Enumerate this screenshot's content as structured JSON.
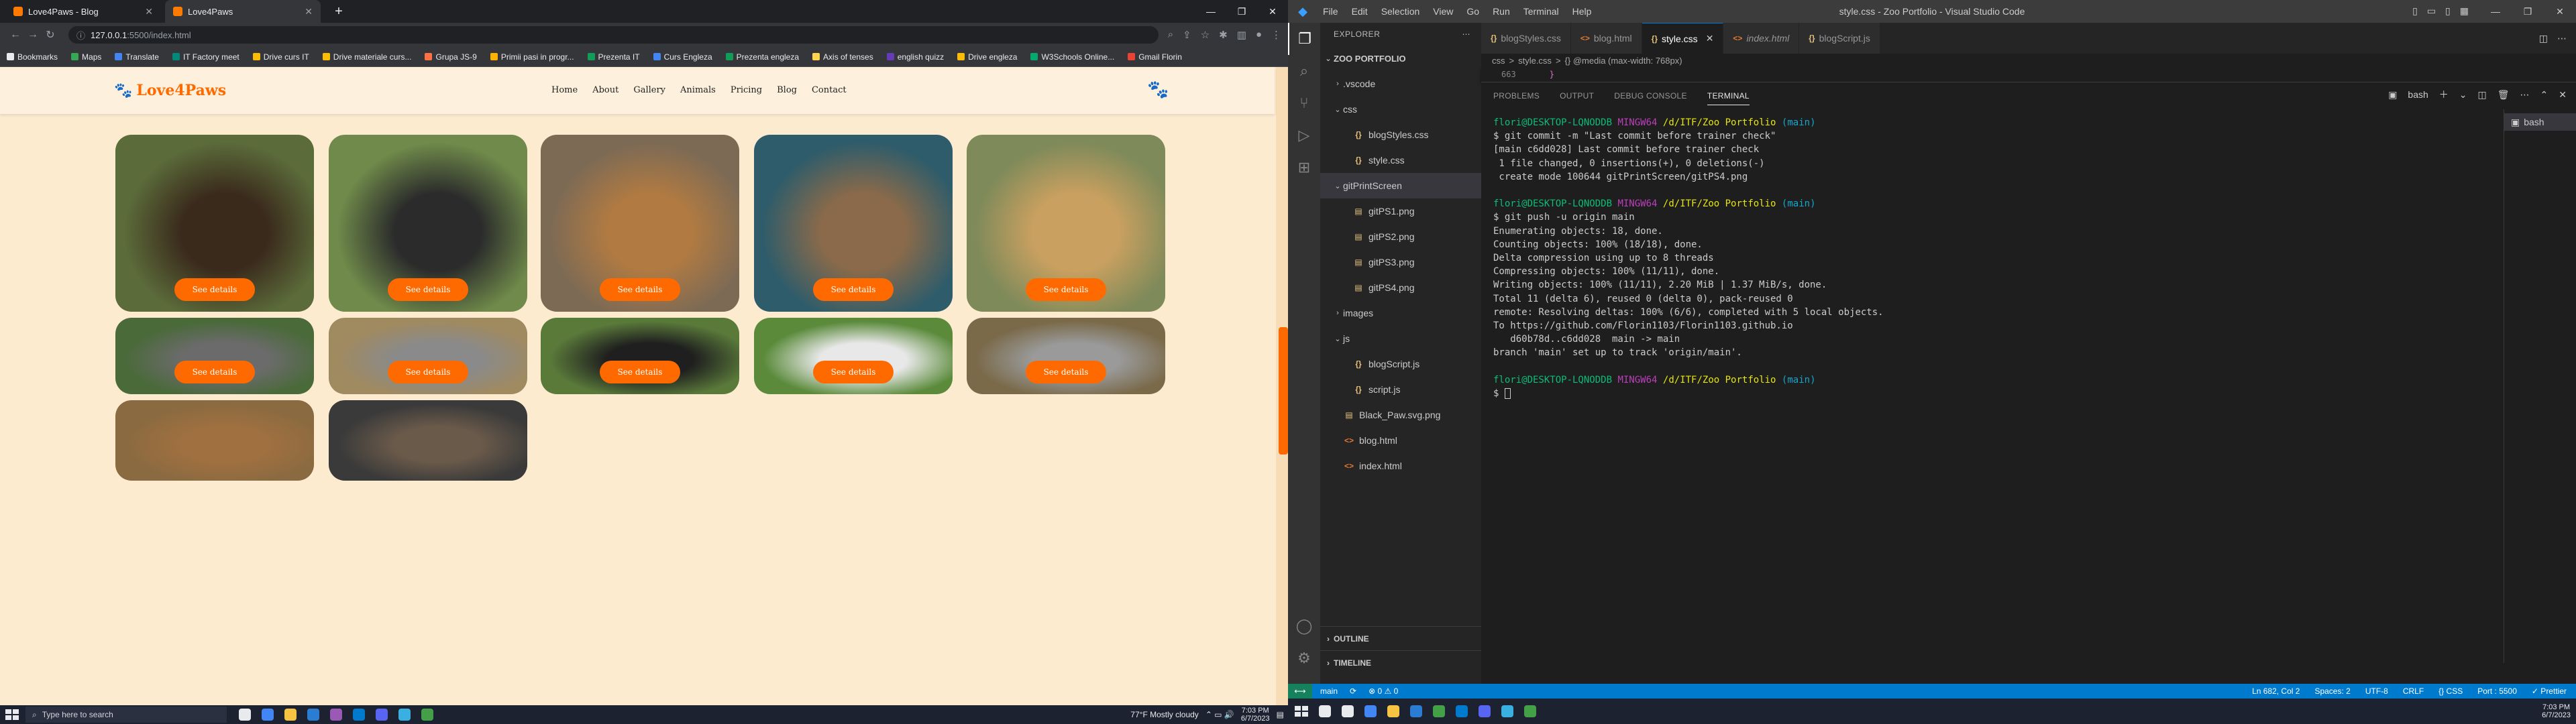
{
  "browser": {
    "tabs": [
      {
        "label": "Love4Paws - Blog",
        "active": false
      },
      {
        "label": "Love4Paws",
        "active": true
      }
    ],
    "new_tab": "+",
    "window_controls": [
      "—",
      "❐",
      "✕"
    ],
    "url_host": "127.0.0.1",
    "url_path": ":5500/index.html",
    "bookmarks": [
      {
        "label": "Bookmarks",
        "color": "#e8eaed"
      },
      {
        "label": "Maps",
        "color": "#34a853"
      },
      {
        "label": "Translate",
        "color": "#4285f4"
      },
      {
        "label": "IT Factory meet",
        "color": "#00897b"
      },
      {
        "label": "Drive curs IT",
        "color": "#fbbc04"
      },
      {
        "label": "Drive materiale curs...",
        "color": "#fbbc04"
      },
      {
        "label": "Grupa JS-9",
        "color": "#ff7043"
      },
      {
        "label": "Primii pasi in progr...",
        "color": "#ffb300"
      },
      {
        "label": "Prezenta IT",
        "color": "#0f9d58"
      },
      {
        "label": "Curs Engleza",
        "color": "#4285f4"
      },
      {
        "label": "Prezenta engleza",
        "color": "#0f9d58"
      },
      {
        "label": "Axis of tenses",
        "color": "#ffd54f"
      },
      {
        "label": "english quizz",
        "color": "#673ab7"
      },
      {
        "label": "Drive engleza",
        "color": "#fbbc04"
      },
      {
        "label": "W3Schools Online...",
        "color": "#04aa6d"
      },
      {
        "label": "Gmail Florin",
        "color": "#ea4335"
      }
    ]
  },
  "site": {
    "logo_text": "Love4Paws",
    "nav": [
      "Home",
      "About",
      "Gallery",
      "Animals",
      "Pricing",
      "Blog",
      "Contact"
    ],
    "button_label": "See details",
    "cards": [
      {
        "animal": "bear",
        "c1": "#5b6b3a",
        "c2": "#3a2a1c"
      },
      {
        "animal": "zebra",
        "c1": "#6f8a4a",
        "c2": "#2b2b2b"
      },
      {
        "animal": "giraffe",
        "c1": "#7c6a55",
        "c2": "#b07a42"
      },
      {
        "animal": "monkey",
        "c1": "#2f5c6a",
        "c2": "#8a6a4a"
      },
      {
        "animal": "serval",
        "c1": "#7f8a5a",
        "c2": "#c9a060"
      },
      {
        "animal": "raccoon",
        "c1": "#4a6a3a",
        "c2": "#6b6b6b"
      },
      {
        "animal": "wolf",
        "c1": "#a08a60",
        "c2": "#8a8a8a"
      },
      {
        "animal": "gorilla",
        "c1": "#5a7a3a",
        "c2": "#1f1f1f"
      },
      {
        "animal": "white tiger",
        "c1": "#5a8a3a",
        "c2": "#e8e8e8"
      },
      {
        "animal": "koala",
        "c1": "#7a6a4a",
        "c2": "#9a9a9a"
      },
      {
        "animal": "lion",
        "c1": "#8a6a40",
        "c2": "#a07040"
      },
      {
        "animal": "deer",
        "c1": "#3a3a3a",
        "c2": "#6a5a4a"
      }
    ]
  },
  "win_taskbar": {
    "search_placeholder": "Type here to search",
    "weather": "77°F  Mostly cloudy",
    "time": "7:03 PM",
    "date": "6/7/2023"
  },
  "vscode": {
    "menu": [
      "File",
      "Edit",
      "Selection",
      "View",
      "Go",
      "Run",
      "Terminal",
      "Help"
    ],
    "title": "style.css - Zoo Portfolio - Visual Studio Code",
    "explorer_title": "EXPLORER",
    "root_folder": "ZOO PORTFOLIO",
    "tree": [
      {
        "label": ".vscode",
        "type": "folder",
        "depth": 1,
        "open": false
      },
      {
        "label": "css",
        "type": "folder",
        "depth": 1,
        "open": true
      },
      {
        "label": "blogStyles.css",
        "type": "css",
        "depth": 2
      },
      {
        "label": "style.css",
        "type": "css",
        "depth": 2
      },
      {
        "label": "gitPrintScreen",
        "type": "folder",
        "depth": 1,
        "open": true,
        "selected": true
      },
      {
        "label": "gitPS1.png",
        "type": "png",
        "depth": 2
      },
      {
        "label": "gitPS2.png",
        "type": "png",
        "depth": 2
      },
      {
        "label": "gitPS3.png",
        "type": "png",
        "depth": 2
      },
      {
        "label": "gitPS4.png",
        "type": "png",
        "depth": 2
      },
      {
        "label": "images",
        "type": "folder",
        "depth": 1,
        "open": false
      },
      {
        "label": "js",
        "type": "folder",
        "depth": 1,
        "open": true
      },
      {
        "label": "blogScript.js",
        "type": "js",
        "depth": 2
      },
      {
        "label": "script.js",
        "type": "js",
        "depth": 2
      },
      {
        "label": "Black_Paw.svg.png",
        "type": "png",
        "depth": 1
      },
      {
        "label": "blog.html",
        "type": "html",
        "depth": 1
      },
      {
        "label": "index.html",
        "type": "html",
        "depth": 1
      }
    ],
    "outline": "OUTLINE",
    "timeline": "TIMELINE",
    "tabs": [
      {
        "label": "blogStyles.css",
        "icon": "{}",
        "color": "#e5c07b",
        "active": false,
        "italic": false
      },
      {
        "label": "blog.html",
        "icon": "<>",
        "color": "#e37933",
        "active": false,
        "italic": false
      },
      {
        "label": "style.css",
        "icon": "{}",
        "color": "#e5c07b",
        "active": true,
        "italic": false
      },
      {
        "label": "index.html",
        "icon": "<>",
        "color": "#e37933",
        "active": false,
        "italic": true
      },
      {
        "label": "blogScript.js",
        "icon": "{}",
        "color": "#e5c07b",
        "active": false,
        "italic": false
      }
    ],
    "breadcrumbs": [
      "css",
      ">",
      "style.css",
      ">",
      "{} @media (max-width: 768px)"
    ],
    "code_line_number": "663",
    "code_line_text": "}",
    "panel_tabs": [
      "PROBLEMS",
      "OUTPUT",
      "DEBUG CONSOLE",
      "TERMINAL"
    ],
    "shell_name": "bash",
    "prompt_user": "flori@DESKTOP-LQNODDB",
    "prompt_host": "MINGW64",
    "prompt_path": "/d/ITF/Zoo Portfolio",
    "prompt_branch": "(main)",
    "commit_cmd": "$ git commit -m \"Last commit before trainer check\"",
    "commit_out": [
      "[main c6dd028] Last commit before trainer check",
      " 1 file changed, 0 insertions(+), 0 deletions(-)",
      " create mode 100644 gitPrintScreen/gitPS4.png"
    ],
    "push_cmd": "$ git push -u origin main",
    "push_out": [
      "Enumerating objects: 18, done.",
      "Counting objects: 100% (18/18), done.",
      "Delta compression using up to 8 threads",
      "Compressing objects: 100% (11/11), done.",
      "Writing objects: 100% (11/11), 2.20 MiB | 1.37 MiB/s, done.",
      "Total 11 (delta 6), reused 0 (delta 0), pack-reused 0",
      "remote: Resolving deltas: 100% (6/6), completed with 5 local objects.",
      "To https://github.com/Florin1103/Florin1103.github.io",
      "   d60b78d..c6dd028  main -> main",
      "branch 'main' set up to track 'origin/main'."
    ],
    "final_prompt": "$ ",
    "status_left": [
      "main",
      "⟳",
      "⊗ 0 ⚠ 0"
    ],
    "status_right": [
      "Ln 682, Col 2",
      "Spaces: 2",
      "UTF-8",
      "CRLF",
      "{} CSS",
      "Port : 5500",
      "✓ Prettier"
    ]
  }
}
